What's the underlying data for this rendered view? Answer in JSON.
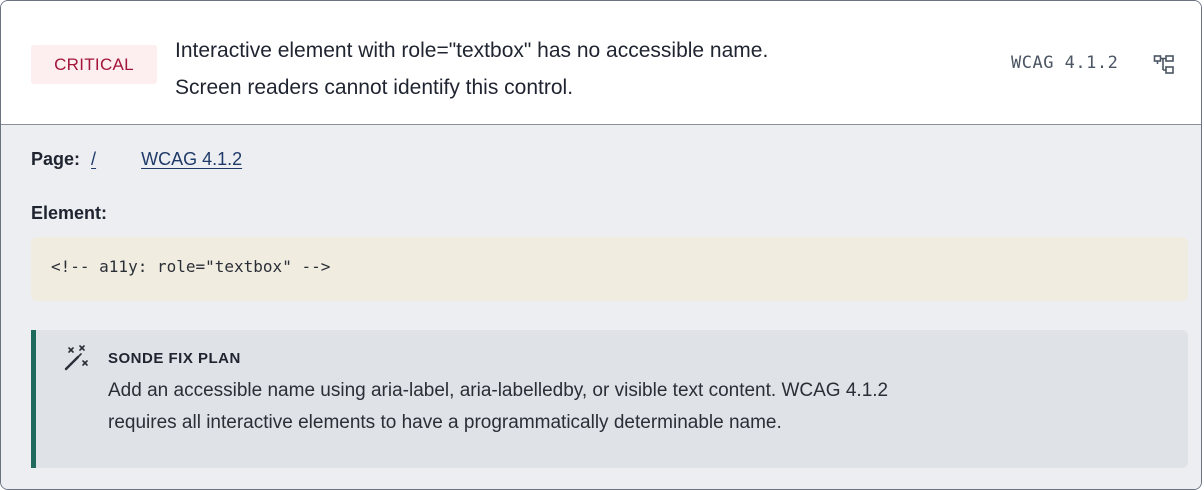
{
  "issue": {
    "severity": "CRITICAL",
    "message_lines": [
      "Interactive element with role=\"textbox\" has no accessible name.",
      "Screen readers cannot identify this control."
    ],
    "rule_ref": "WCAG 4.1.2",
    "rule_icon": "tree-structure-icon"
  },
  "details": {
    "page_label": "Page:",
    "page_link": "/",
    "wcag_link": "WCAG 4.1.2",
    "element_label": "Element:",
    "element_code": "<!-- a11y: role=\"textbox\" -->"
  },
  "fix_plan": {
    "icon": "magic-wand-icon",
    "title": "SONDE FIX PLAN",
    "text_lines": [
      "Add an accessible name using aria-label, aria-labelledby, or visible text content. WCAG 4.1.2",
      "requires all interactive elements to have a programmatically determinable name."
    ]
  },
  "colors": {
    "severity_text": "#a4153a",
    "severity_bg": "#fdeef0",
    "link": "#1f3a68",
    "code_bg": "#f0ece0",
    "fix_accent": "#1e6a5c",
    "fix_bg": "#dfe2e7",
    "body_bg": "#eceef2"
  }
}
